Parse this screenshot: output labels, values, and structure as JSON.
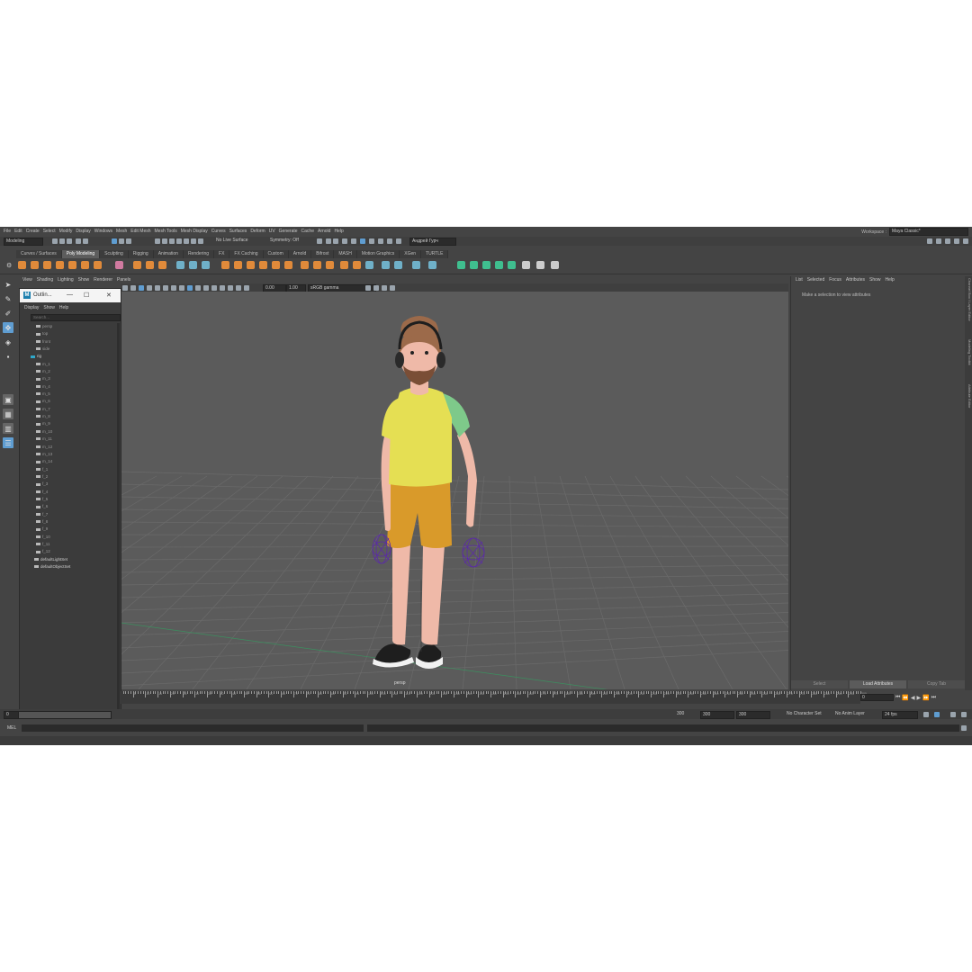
{
  "menubar": {
    "items": [
      "File",
      "Edit",
      "Create",
      "Select",
      "Modify",
      "Display",
      "Windows",
      "Mesh",
      "Edit Mesh",
      "Mesh Tools",
      "Mesh Display",
      "Curves",
      "Surfaces",
      "Deform",
      "UV",
      "Generate",
      "Cache",
      "Arnold",
      "Help"
    ],
    "workspace_label": "Workspace :",
    "workspace_value": "Maya Classic*"
  },
  "statusline": {
    "mode": "Modeling",
    "live_surface": "No Live Surface",
    "symmetry": "Symmetry: Off",
    "user": "Андрей Гурч"
  },
  "shelf": {
    "tabs": [
      "Curves / Surfaces",
      "Poly Modeling",
      "Sculpting",
      "Rigging",
      "Animation",
      "Rendering",
      "FX",
      "FX Caching",
      "Custom",
      "Arnold",
      "Bifrost",
      "MASH",
      "Motion Graphics",
      "XGen",
      "TURTLE"
    ],
    "active_tab": "Poly Modeling"
  },
  "panel": {
    "menu": [
      "View",
      "Shading",
      "Lighting",
      "Show",
      "Renderer",
      "Panels"
    ],
    "exposure": "0.00",
    "gamma": "1.00",
    "colorspace": "sRGB gamma",
    "camera_label": "persp"
  },
  "outliner": {
    "title": "Outlin...",
    "menu": [
      "Display",
      "Show",
      "Help"
    ],
    "search_placeholder": "Search...",
    "items": [
      "persp",
      "top",
      "front",
      "side",
      "rig",
      "m_1",
      "m_2",
      "m_3",
      "m_4",
      "m_5",
      "m_6",
      "m_7",
      "m_8",
      "m_9",
      "m_10",
      "m_11",
      "m_12",
      "m_13",
      "m_14",
      "f_1",
      "f_2",
      "f_3",
      "f_4",
      "f_5",
      "f_6",
      "f_7",
      "f_8",
      "f_9",
      "f_10",
      "f_11",
      "f_12",
      "defaultLightSet",
      "defaultObjectSet"
    ]
  },
  "attribute_editor": {
    "menu": [
      "List",
      "Selected",
      "Focus",
      "Attributes",
      "Show",
      "Help"
    ],
    "message": "Make a selection to view attributes",
    "buttons": [
      "Select",
      "Load Attributes",
      "Copy Tab"
    ],
    "side_tabs": [
      "Channel Box / Layer Editor",
      "Modeling Toolkit",
      "Attribute Editor"
    ]
  },
  "timeline": {
    "ticks": [
      "5",
      "10",
      "15",
      "20",
      "25",
      "30",
      "35",
      "40",
      "45",
      "50",
      "55",
      "60",
      "65",
      "70",
      "75",
      "80",
      "85",
      "90",
      "95",
      "100",
      "105",
      "110",
      "115",
      "120",
      "125",
      "130",
      "135",
      "140",
      "145",
      "150",
      "155",
      "160",
      "165",
      "170",
      "175",
      "180",
      "185",
      "190",
      "195",
      "200",
      "205",
      "210",
      "215",
      "220",
      "225",
      "230",
      "235",
      "240",
      "245",
      "250",
      "255",
      "260",
      "265",
      "270",
      "275",
      "280",
      "285",
      "290",
      "295",
      "300"
    ],
    "current_frame": "0"
  },
  "range": {
    "start": "0",
    "range_start": "0",
    "range_end_label": "300",
    "end1": "300",
    "end2": "300",
    "character_set": "No Character Set",
    "anim_layer": "No Anim Layer",
    "fps": "24 fps"
  },
  "cmd": {
    "label": "MEL"
  },
  "colors": {
    "viewport_bg": "#5b5b5b",
    "shirt": "#e5df53",
    "sleeve": "#7ec98a",
    "shorts": "#d99a2a",
    "skin": "#efb9a8",
    "hair": "#9c6a4a",
    "control_curve": "#5b2aa8",
    "accent": "#2fa7c9"
  }
}
